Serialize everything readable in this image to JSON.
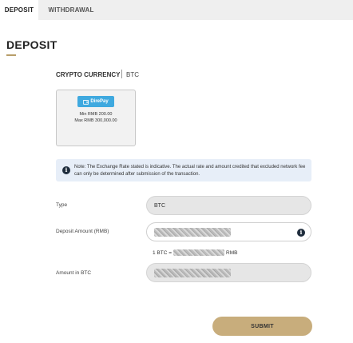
{
  "tabs": {
    "deposit": "DEPOSIT",
    "withdrawal": "WITHDRAWAL"
  },
  "page": {
    "title": "DEPOSIT"
  },
  "crypto": {
    "label": "CRYPTO CURRENCY",
    "value": "BTC"
  },
  "payment_method": {
    "logo_text": "DirePay",
    "min": "Min RMB 200.00",
    "max": "Max RMB 300,000.00"
  },
  "note": {
    "icon": "info-icon",
    "text": "Note: The Exchange Rate stated is indicative. The actual rate and amount credited that excluded network fee can only be determined after submission of the transaction."
  },
  "form": {
    "type_label": "Type",
    "type_value": "BTC",
    "amount_label": "Deposit Amount (RMB)",
    "amount_value": "",
    "rate_prefix": "1 BTC =",
    "rate_suffix": "RMB",
    "btc_label": "Amount in BTC",
    "btc_value": ""
  },
  "submit": {
    "label": "SUBMIT"
  },
  "colors": {
    "accent": "#c8ad7c",
    "tabbar": "#efefef",
    "note_bg": "#e7eef8",
    "logo_blue": "#3fa9df"
  }
}
